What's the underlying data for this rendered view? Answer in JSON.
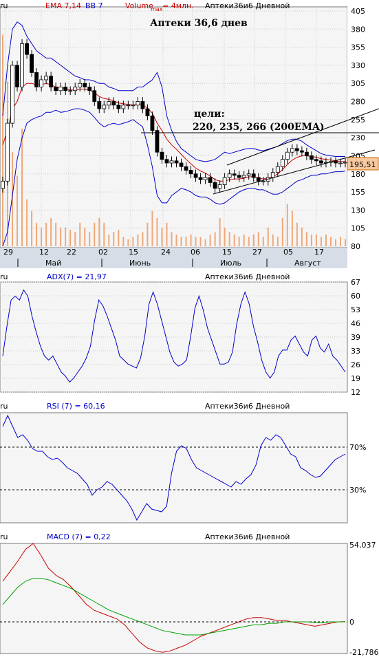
{
  "colors": {
    "background": "#f5f5f5",
    "grid": "#cccccc",
    "axis_bg": "#d6dde6",
    "candle_up": "#ffffff",
    "candle_down": "#000000",
    "ema": "#cc0000",
    "bb": "#0000cc",
    "volume": "#f0a878",
    "adx": "#0000cc",
    "rsi": "#0000cc",
    "macd": "#cc0000",
    "signal": "#00a000",
    "price_badge": "#f6c9a0"
  },
  "main": {
    "source_label": "ru",
    "legend_ema": "EMA 7,14",
    "legend_bb": "BB 7",
    "legend_volume": "Volume",
    "legend_volume_sub": "max",
    "legend_volume_suffix": "= 4млн.",
    "legend_name": "Аптеки36и6 Дневной",
    "title": "Аптеки 36,6 днев",
    "annotation_line1": "цели:",
    "annotation_line2": "220, 235, 266 (200EMA)",
    "last_price": "195,51",
    "y_ticks": [
      "405",
      "380",
      "355",
      "330",
      "305",
      "280",
      "255",
      "230",
      "205",
      "180",
      "155",
      "130",
      "105",
      "80"
    ],
    "x_day_ticks": [
      "29",
      "12",
      "22",
      "02",
      "15",
      "24",
      "06",
      "15",
      "27",
      "05",
      "17"
    ],
    "x_month_labels": [
      "Май",
      "Июнь",
      "Июль",
      "Август"
    ]
  },
  "adx": {
    "source_label": "ru",
    "legend": "ADX(7) = 21,97",
    "legend_name": "Аптеки36и6 Дневной",
    "y_ticks": [
      "67",
      "60",
      "53",
      "46",
      "39",
      "33",
      "26",
      "19",
      "12"
    ]
  },
  "rsi": {
    "source_label": "ru",
    "legend": "RSI (7) = 60,16",
    "legend_name": "Аптеки36и6 Дневной",
    "y_ticks": [
      "70%",
      "30%"
    ]
  },
  "macd": {
    "source_label": "ru",
    "legend": "MACD (7) = 0,22",
    "legend_name": "Аптеки36и6 Дневной",
    "y_ticks": [
      "54,037",
      "0",
      "-21,786"
    ]
  },
  "chart_data": [
    {
      "type": "candlestick",
      "title": "Аптеки 36,6 днев",
      "ylim": [
        80,
        405
      ],
      "x_ticks": [
        "29",
        "12",
        "22",
        "02",
        "15",
        "24",
        "06",
        "15",
        "27",
        "05",
        "17"
      ],
      "x_months": [
        "Май",
        "Июнь",
        "Июль",
        "Август"
      ],
      "close": [
        170,
        250,
        330,
        300,
        360,
        345,
        320,
        300,
        310,
        315,
        300,
        295,
        300,
        295,
        295,
        300,
        305,
        300,
        295,
        280,
        270,
        275,
        280,
        275,
        270,
        275,
        275,
        275,
        280,
        270,
        260,
        240,
        210,
        200,
        195,
        198,
        195,
        190,
        185,
        180,
        175,
        172,
        175,
        168,
        160,
        165,
        175,
        180,
        178,
        175,
        178,
        180,
        175,
        170,
        170,
        175,
        182,
        190,
        200,
        210,
        215,
        212,
        210,
        205,
        200,
        198,
        195,
        196,
        197,
        195,
        195,
        196
      ],
      "ema": [
        220,
        240,
        270,
        280,
        300,
        305,
        305,
        303,
        303,
        305,
        303,
        300,
        299,
        298,
        296,
        296,
        297,
        297,
        296,
        292,
        287,
        284,
        283,
        281,
        278,
        277,
        276,
        275,
        276,
        275,
        271,
        264,
        250,
        240,
        228,
        220,
        214,
        207,
        200,
        194,
        188,
        184,
        181,
        177,
        172,
        170,
        170,
        172,
        173,
        173,
        174,
        176,
        176,
        174,
        173,
        174,
        176,
        180,
        186,
        193,
        199,
        203,
        205,
        205,
        204,
        203,
        201,
        200,
        199,
        198,
        197,
        197
      ],
      "bb_upper": [
        260,
        330,
        380,
        390,
        385,
        370,
        360,
        350,
        345,
        340,
        340,
        335,
        330,
        325,
        320,
        315,
        313,
        310,
        310,
        308,
        305,
        305,
        300,
        298,
        295,
        295,
        295,
        295,
        300,
        300,
        305,
        310,
        320,
        300,
        260,
        240,
        225,
        215,
        210,
        205,
        200,
        198,
        197,
        198,
        200,
        205,
        210,
        208,
        210,
        212,
        214,
        215,
        215,
        213,
        212,
        214,
        216,
        218,
        222,
        226,
        228,
        228,
        225,
        220,
        216,
        212,
        208,
        206,
        205,
        204,
        204,
        204
      ],
      "bb_lower": [
        80,
        100,
        150,
        200,
        230,
        250,
        255,
        258,
        260,
        265,
        265,
        268,
        265,
        266,
        268,
        270,
        270,
        268,
        265,
        258,
        250,
        245,
        248,
        250,
        248,
        250,
        252,
        255,
        250,
        245,
        220,
        190,
        150,
        140,
        140,
        150,
        155,
        160,
        158,
        155,
        150,
        148,
        148,
        145,
        140,
        138,
        140,
        145,
        150,
        155,
        158,
        160,
        160,
        158,
        158,
        155,
        152,
        152,
        155,
        160,
        165,
        170,
        172,
        175,
        178,
        178,
        180,
        180,
        182,
        183,
        183,
        184
      ],
      "volume_fraction": [
        0.9,
        0.7,
        0.4,
        0.3,
        0.5,
        0.2,
        0.15,
        0.1,
        0.08,
        0.1,
        0.12,
        0.1,
        0.08,
        0.08,
        0.07,
        0.06,
        0.1,
        0.08,
        0.06,
        0.1,
        0.12,
        0.1,
        0.05,
        0.06,
        0.07,
        0.04,
        0.03,
        0.04,
        0.05,
        0.06,
        0.1,
        0.15,
        0.12,
        0.08,
        0.1,
        0.06,
        0.05,
        0.04,
        0.04,
        0.05,
        0.04,
        0.04,
        0.03,
        0.05,
        0.06,
        0.12,
        0.08,
        0.06,
        0.05,
        0.04,
        0.05,
        0.04,
        0.05,
        0.06,
        0.04,
        0.08,
        0.05,
        0.04,
        0.12,
        0.18,
        0.15,
        0.1,
        0.08,
        0.06,
        0.05,
        0.05,
        0.04,
        0.05,
        0.04,
        0.03,
        0.04,
        0.03
      ]
    },
    {
      "type": "line",
      "title": "ADX(7) = 21,97",
      "ylim": [
        12,
        67
      ],
      "values": [
        30,
        45,
        58,
        60,
        58,
        63,
        60,
        50,
        42,
        35,
        30,
        28,
        30,
        26,
        22,
        20,
        17,
        19,
        22,
        25,
        29,
        35,
        48,
        58,
        55,
        50,
        44,
        38,
        30,
        28,
        26,
        25,
        24,
        29,
        40,
        56,
        62,
        56,
        48,
        40,
        32,
        27,
        25,
        26,
        28,
        40,
        54,
        60,
        53,
        44,
        38,
        32,
        26,
        26,
        27,
        32,
        46,
        56,
        62,
        56,
        45,
        37,
        28,
        22,
        19,
        22,
        30,
        33,
        33,
        38,
        40,
        36,
        32,
        30,
        38,
        40,
        34,
        32,
        36,
        30,
        28,
        25,
        22
      ]
    },
    {
      "type": "line",
      "title": "RSI (7) = 60,16",
      "ylim": [
        0,
        100
      ],
      "reference_lines": [
        70,
        30
      ],
      "values": [
        80,
        88,
        80,
        72,
        74,
        70,
        64,
        62,
        62,
        58,
        56,
        57,
        54,
        50,
        48,
        46,
        42,
        38,
        30,
        34,
        36,
        40,
        38,
        34,
        30,
        26,
        20,
        12,
        18,
        24,
        20,
        19,
        18,
        22,
        46,
        62,
        66,
        64,
        56,
        50,
        48,
        46,
        44,
        42,
        40,
        38,
        36,
        40,
        38,
        42,
        45,
        52,
        66,
        72,
        70,
        74,
        72,
        66,
        60,
        58,
        50,
        48,
        45,
        43,
        44,
        48,
        52,
        56,
        58,
        60
      ]
    },
    {
      "type": "line",
      "title": "MACD (7) = 0,22",
      "ylim": [
        -21.786,
        54.037
      ],
      "series": [
        {
          "name": "",
          "values": [
            28,
            35,
            42,
            50,
            54,
            46,
            37,
            32,
            29,
            24,
            18,
            12,
            8,
            6,
            4,
            2,
            -2,
            -8,
            -14,
            -18,
            -20,
            -21,
            -20,
            -18,
            -16,
            -13,
            -10,
            -8,
            -6,
            -4,
            -2,
            0,
            2,
            3,
            3,
            2,
            1,
            1,
            0,
            -1,
            -2,
            -3,
            -2,
            -1,
            0,
            0.22
          ]
        },
        {
          "name": "",
          "values": [
            12,
            18,
            24,
            28,
            30,
            30,
            29,
            27,
            25,
            23,
            20,
            17,
            14,
            11,
            8,
            6,
            4,
            2,
            0,
            -2,
            -4,
            -6,
            -7,
            -8,
            -9,
            -9,
            -9,
            -8,
            -7,
            -6,
            -5,
            -4,
            -3,
            -2,
            -2,
            -1,
            -1,
            0,
            0,
            0,
            0,
            -0.5,
            -0.5,
            0,
            0,
            0
          ]
        }
      ]
    }
  ]
}
